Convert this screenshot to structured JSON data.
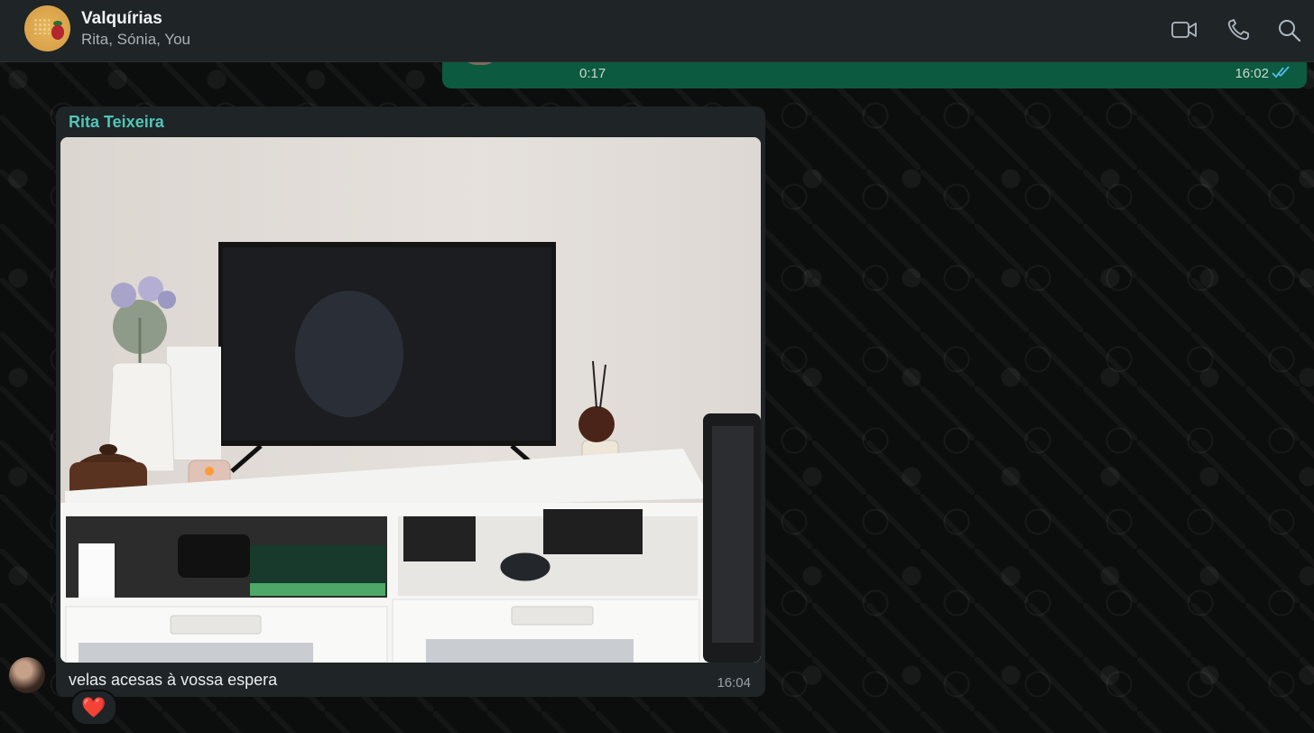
{
  "header": {
    "title": "Valquírias",
    "subtitle": "Rita, Sónia, You",
    "icons": [
      "video-call-icon",
      "voice-call-icon",
      "search-icon"
    ]
  },
  "outgoing_message": {
    "type": "voice",
    "duration": "0:17",
    "time": "16:02",
    "status": "read"
  },
  "incoming_message": {
    "sender": "Rita Teixeira",
    "type": "image",
    "caption": "velas acesas à vossa espera",
    "time": "16:04",
    "reaction": "❤️"
  },
  "colors": {
    "header_bg": "#1f2427",
    "outgoing_bubble": "#0c5a3f",
    "incoming_bubble": "#1f2427",
    "sender_name": "#4fc7b6",
    "read_ticks": "#53bdeb"
  }
}
